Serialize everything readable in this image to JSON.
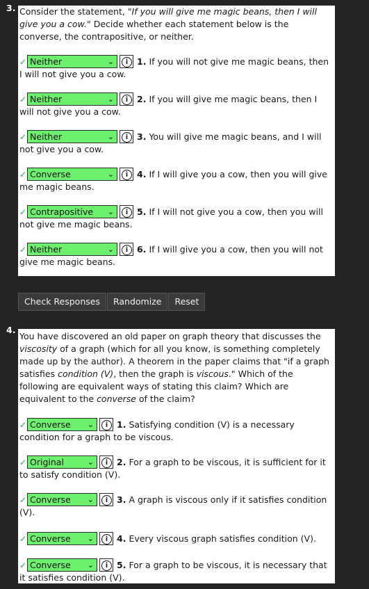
{
  "q3": {
    "number": "3.",
    "intro_part1": "Consider the statement, ",
    "intro_quote": "\"If you will give me magic beans, then I will give you a cow.\"",
    "intro_part2": " Decide whether each statement below is the converse, the contrapositive, or neither.",
    "items": [
      {
        "answer": "Neither",
        "num": "1.",
        "text": "If you will not give me magic beans, then I will not give you a cow."
      },
      {
        "answer": "Neither",
        "num": "2.",
        "text": "If you will give me magic beans, then I will not give you a cow."
      },
      {
        "answer": "Neither",
        "num": "3.",
        "text": "You will give me magic beans, and I will not give you a cow."
      },
      {
        "answer": "Converse",
        "num": "4.",
        "text": "If I will give you a cow, then you will give me magic beans."
      },
      {
        "answer": "Contrapositive",
        "num": "5.",
        "text": "If I will not give you a cow, then you will not give me magic beans."
      },
      {
        "answer": "Neither",
        "num": "6.",
        "text": "If I will give you a cow, then you will not give me magic beans."
      }
    ]
  },
  "buttons": {
    "check": "Check Responses",
    "randomize": "Randomize",
    "reset": "Reset"
  },
  "q4": {
    "number": "4.",
    "p1": "You have discovered an old paper on graph theory that discusses the ",
    "p1_em": "viscosity",
    "p2": " of a graph (which for all you know, is something completely made up by the author). A theorem in the paper claims that \"if a graph satisfies ",
    "p2_em": "condition (V)",
    "p3": ", then the graph is ",
    "p3_em": "viscous",
    "p4": ".\" Which of the following are equivalent ways of stating this claim? Which are equivalent to the ",
    "p4_em": "converse",
    "p5": " of the claim?",
    "items": [
      {
        "answer": "Converse",
        "num": "1.",
        "text": "Satisfying condition (V) is a necessary condition for a graph to be viscous."
      },
      {
        "answer": "Original",
        "num": "2.",
        "text": "For a graph to be viscous, it is sufficient for it to satisfy condition (V)."
      },
      {
        "answer": "Converse",
        "num": "3.",
        "text": "A graph is viscous only if it satisfies condition (V)."
      },
      {
        "answer": "Converse",
        "num": "4.",
        "text": "Every viscous graph satisfies condition (V)."
      },
      {
        "answer": "Converse",
        "num": "5.",
        "text": "For a graph to be viscous, it is necessary that it satisfies condition (V)."
      }
    ]
  },
  "colors": {
    "correct": "#2da44e",
    "select_bg": "#6df06d",
    "page_bg": "#242424"
  },
  "icons": {
    "check": "checkmark-icon",
    "info": "info-icon",
    "dropdown": "chevron-down-icon"
  }
}
